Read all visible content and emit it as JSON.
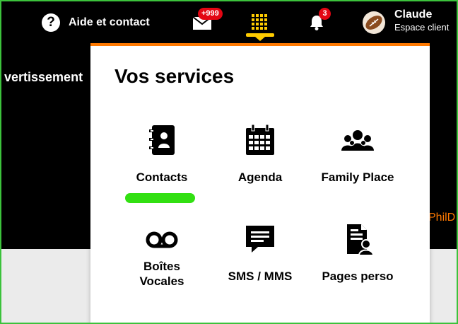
{
  "header": {
    "help_label": "Aide et contact",
    "mail_badge": "+999",
    "notifications_badge": "3",
    "user_name": "Claude",
    "user_subtitle": "Espace client"
  },
  "background": {
    "left_text": "vertissement",
    "right_text": "PhilD"
  },
  "services_panel": {
    "title": "Vos services",
    "items": [
      {
        "label": "Contacts",
        "icon": "contacts-book-icon",
        "active": true
      },
      {
        "label": "Agenda",
        "icon": "calendar-icon"
      },
      {
        "label": "Family Place",
        "icon": "family-icon"
      },
      {
        "label_line1": "Boîtes",
        "label_line2": "Vocales",
        "icon": "voicemail-icon"
      },
      {
        "label": "SMS / MMS",
        "icon": "message-icon"
      },
      {
        "label": "Pages perso",
        "icon": "personal-page-icon"
      }
    ]
  },
  "colors": {
    "accent": "#ff7900",
    "apps_icon": "#ffcc00",
    "badge": "#e30613",
    "active_indicator": "#32e012",
    "frame": "#3cc23c"
  }
}
